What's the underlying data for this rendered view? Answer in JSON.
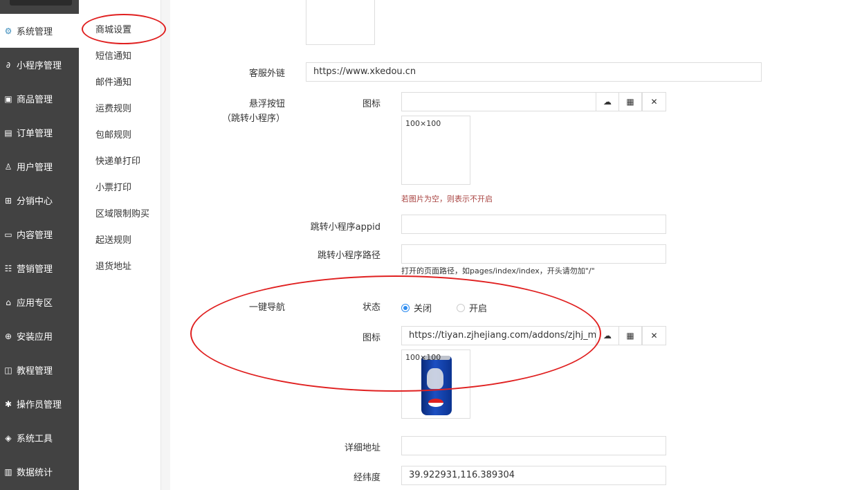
{
  "sidebar": {
    "items": [
      {
        "label": "系统管理",
        "icon": "gear-icon",
        "glyph": "⚙",
        "active": true
      },
      {
        "label": "小程序管理",
        "icon": "link-icon",
        "glyph": "∂"
      },
      {
        "label": "商品管理",
        "icon": "box-icon",
        "glyph": "▣"
      },
      {
        "label": "订单管理",
        "icon": "order-icon",
        "glyph": "▤"
      },
      {
        "label": "用户管理",
        "icon": "user-icon",
        "glyph": "♙"
      },
      {
        "label": "分销中心",
        "icon": "network-icon",
        "glyph": "⊞"
      },
      {
        "label": "内容管理",
        "icon": "content-icon",
        "glyph": "▭"
      },
      {
        "label": "营销管理",
        "icon": "marketing-icon",
        "glyph": "☷"
      },
      {
        "label": "应用专区",
        "icon": "app-icon",
        "glyph": "⌂"
      },
      {
        "label": "安装应用",
        "icon": "install-icon",
        "glyph": "⊕"
      },
      {
        "label": "教程管理",
        "icon": "book-icon",
        "glyph": "◫"
      },
      {
        "label": "操作员管理",
        "icon": "cog-icon",
        "glyph": "✱"
      },
      {
        "label": "系统工具",
        "icon": "tool-icon",
        "glyph": "◈"
      },
      {
        "label": "数据统计",
        "icon": "chart-icon",
        "glyph": "▥"
      }
    ]
  },
  "submenu": {
    "items": [
      {
        "label": "商城设置",
        "active": true
      },
      {
        "label": "短信通知"
      },
      {
        "label": "邮件通知"
      },
      {
        "label": "运费规则"
      },
      {
        "label": "包邮规则"
      },
      {
        "label": "快递单打印"
      },
      {
        "label": "小票打印"
      },
      {
        "label": "区域限制购买"
      },
      {
        "label": "起送规则"
      },
      {
        "label": "退货地址"
      }
    ]
  },
  "form": {
    "service_link": {
      "label": "客服外链",
      "value": "https://www.xkedou.cn"
    },
    "float_button": {
      "label": "悬浮按钮",
      "label_sub": "（跳转小程序）",
      "icon_label": "图标",
      "icon_value": "",
      "thumb_size": "100×100",
      "hint": "若图片为空，则表示不开启"
    },
    "appid": {
      "label": "跳转小程序appid",
      "value": ""
    },
    "path": {
      "label": "跳转小程序路径",
      "value": "",
      "hint": "打开的页面路径，如pages/index/index，开头请勿加\"/\""
    },
    "nav": {
      "label": "一键导航",
      "status_label": "状态",
      "option_off": "关闭",
      "option_on": "开启",
      "selected": "关闭",
      "icon_label": "图标",
      "icon_value": "https://tiyan.zjhejiang.com/addons/zjhj_mall",
      "thumb_size": "100×100"
    },
    "address": {
      "label": "详细地址",
      "value": ""
    },
    "latlng": {
      "label": "经纬度",
      "value": "39.922931,116.389304"
    }
  },
  "buttons": {
    "upload": "☁",
    "grid": "▦",
    "close": "✕"
  },
  "colors": {
    "sidebar_bg": "#424242",
    "accent": "#2d8cf0",
    "annotation": "#e02020",
    "hint_red": "#a94442"
  }
}
